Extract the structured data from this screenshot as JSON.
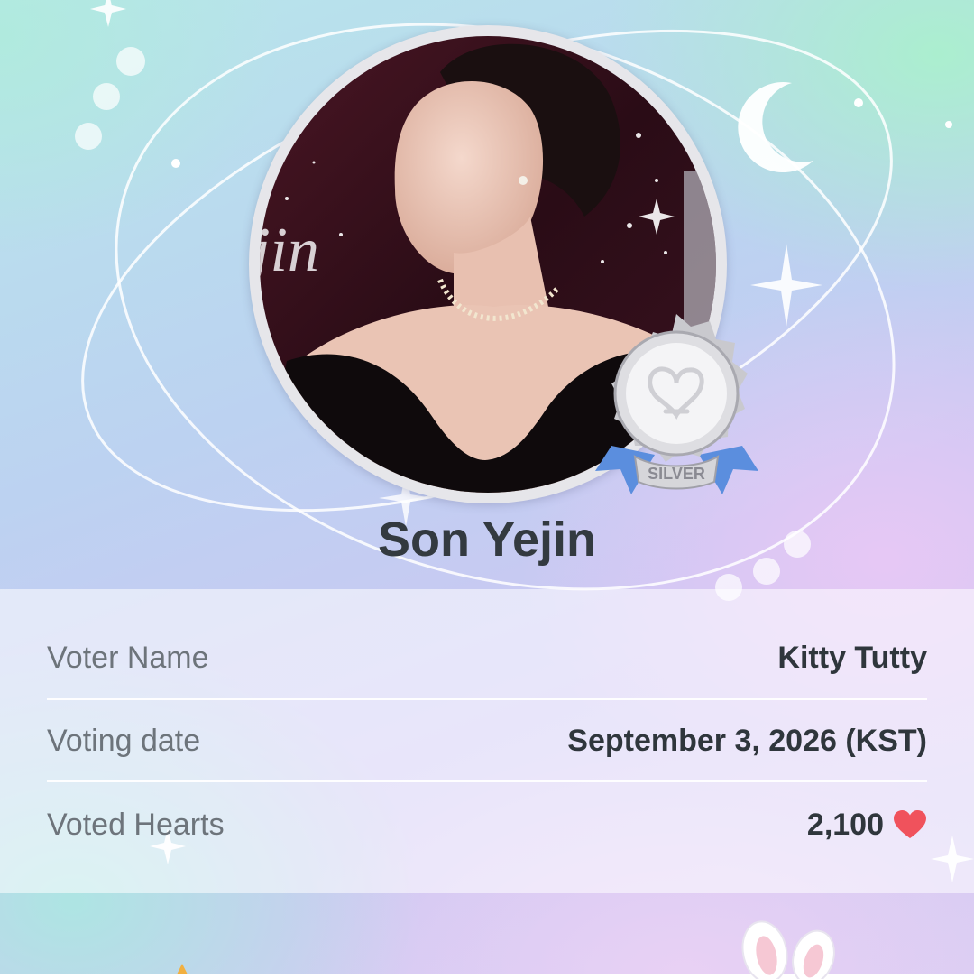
{
  "artist": {
    "name": "Son Yejin",
    "badge": {
      "tier": "SILVER",
      "icon": "silver-medal-icon"
    },
    "photo": {
      "icon": "artist-portrait-image",
      "partial_caption": "jin"
    }
  },
  "vote_info": {
    "rows": [
      {
        "label": "Voter Name",
        "value": "Kitty Tutty"
      },
      {
        "label": "Voting date",
        "value": "September 3, 2026 (KST)"
      },
      {
        "label": "Voted Hearts",
        "value": "2,100",
        "icon": "heart-icon"
      }
    ]
  },
  "theme": {
    "heart_color": "#f0525c",
    "name_color": "#333a40",
    "label_color": "#6d747b",
    "value_color": "#2f363c",
    "ribbon_color": "#5b8ede"
  },
  "decorations": [
    "crescent-moon-icon",
    "sparkle-star-icon",
    "bunny-ears-icon"
  ]
}
